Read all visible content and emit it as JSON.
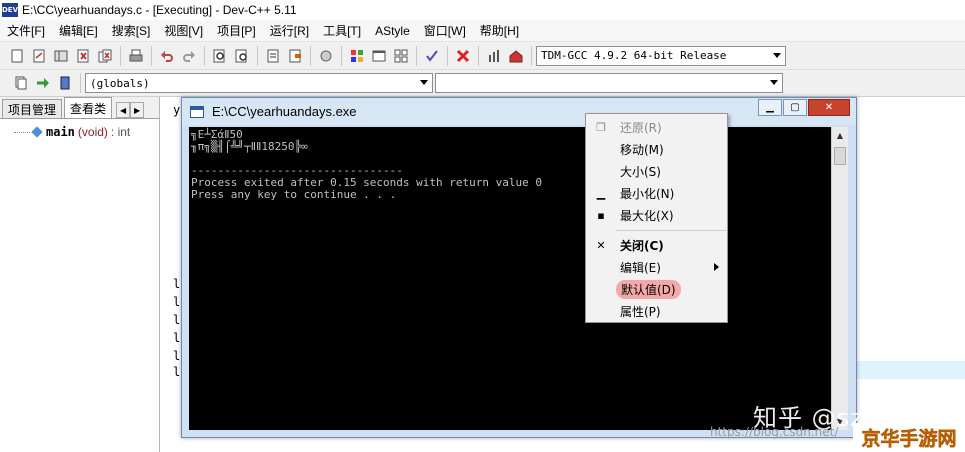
{
  "window": {
    "title": "E:\\CC\\yearhuandays.c - [Executing] - Dev-C++ 5.11",
    "app_icon_text": "DEV"
  },
  "menubar": {
    "items": [
      "文件[F]",
      "编辑[E]",
      "搜索[S]",
      "视图[V]",
      "项目[P]",
      "运行[R]",
      "工具[T]",
      "AStyle",
      "窗口[W]",
      "帮助[H]"
    ]
  },
  "toolbar": {
    "compiler_select": "TDM-GCC 4.9.2 64-bit Release",
    "scope_select": "(globals)",
    "member_select": ""
  },
  "left_panel": {
    "tabs": [
      "项目管理",
      "查看类"
    ],
    "active_tab": 1,
    "tree_item": {
      "name": "main",
      "args": "(void)",
      "ret": ": int"
    }
  },
  "editor": {
    "gutter_chars": [
      "y",
      "l",
      "l",
      "l",
      "l",
      "l",
      "l"
    ]
  },
  "console": {
    "title": "E:\\CC\\yearhuandays.exe",
    "lines": [
      "╗Ε┴ΣάⅡ50",
      "╖π╗▒╢⌠╩╝┬ⅡⅡ18250╠∞",
      "",
      "--------------------------------",
      "Process exited after 0.15 seconds with return value 0",
      "Press any key to continue . . ."
    ]
  },
  "context_menu": {
    "items": [
      {
        "label": "还原(R)",
        "mark": "restore",
        "disabled": true
      },
      {
        "label": "移动(M)",
        "mark": ""
      },
      {
        "label": "大小(S)",
        "mark": ""
      },
      {
        "label": "最小化(N)",
        "mark": "minimize"
      },
      {
        "label": "最大化(X)",
        "mark": "maximize"
      },
      {
        "label": "关闭(C)",
        "mark": "close",
        "bold": true
      },
      {
        "label": "编辑(E)",
        "mark": "",
        "submenu": true
      },
      {
        "label": "默认值(D)",
        "mark": "",
        "highlighted": true
      },
      {
        "label": "属性(P)",
        "mark": ""
      }
    ]
  },
  "watermarks": {
    "zhihu": "知乎 @sz6612",
    "blog": "https://blog.csdn.net/",
    "site": "京华手游网"
  },
  "colors": {
    "console_bg": "#000000",
    "console_text": "#c0c0c0",
    "close_button": "#c7432c",
    "highlight_pill": "#f4a8a8",
    "site_watermark": "#e58a00"
  }
}
